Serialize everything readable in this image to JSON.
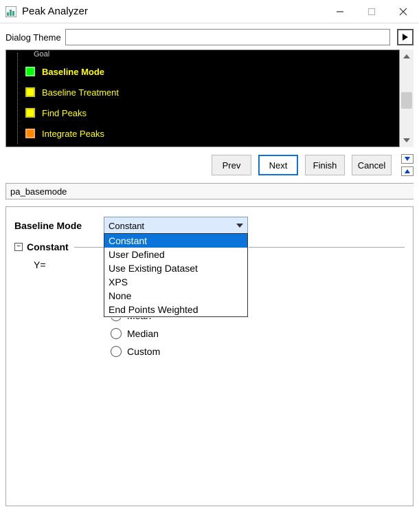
{
  "window": {
    "title": "Peak Analyzer"
  },
  "theme": {
    "label": "Dialog Theme",
    "value": ""
  },
  "steps": [
    {
      "label": "Goal",
      "color": "gray",
      "selected": false,
      "clipped": true
    },
    {
      "label": "Baseline Mode",
      "color": "green",
      "selected": true
    },
    {
      "label": "Baseline Treatment",
      "color": "yellow",
      "selected": false
    },
    {
      "label": "Find Peaks",
      "color": "yellow",
      "selected": false
    },
    {
      "label": "Integrate Peaks",
      "color": "orange",
      "selected": false
    }
  ],
  "nav": {
    "prev": "Prev",
    "next": "Next",
    "finish": "Finish",
    "cancel": "Cancel"
  },
  "page_id": "pa_basemode",
  "form": {
    "baseline_mode_label": "Baseline Mode",
    "baseline_mode_value": "Constant",
    "constant_section": "Constant",
    "y_label": "Y="
  },
  "dropdown": {
    "options": [
      "Constant",
      "User Defined",
      "Use Existing Dataset",
      "XPS",
      "None",
      "End Points Weighted"
    ],
    "selected_index": 0
  },
  "radios": [
    "Mean",
    "Median",
    "Custom"
  ]
}
